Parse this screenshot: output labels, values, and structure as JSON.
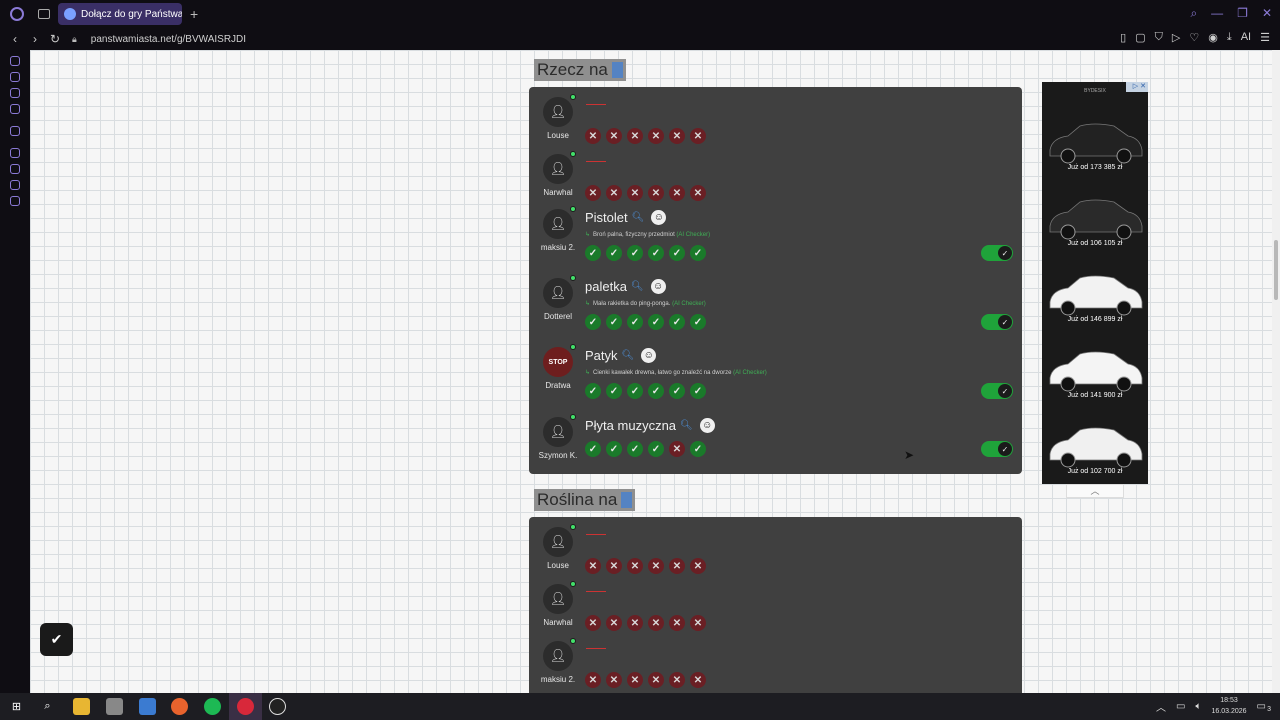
{
  "browser": {
    "tab_title": "Dołącz do gry Państwa Mi...",
    "url": "panstwamiasta.net/g/BVWAISRJDI",
    "ai_label": "AI"
  },
  "sections": [
    {
      "title": "Rzecz na",
      "rows": [
        {
          "player": "Louse",
          "answer": "",
          "description": "",
          "votes": [
            "no",
            "no",
            "no",
            "no",
            "no",
            "no"
          ],
          "has_toggle": false,
          "avatar": "user-icon"
        },
        {
          "player": "Narwhal",
          "answer": "",
          "description": "",
          "votes": [
            "no",
            "no",
            "no",
            "no",
            "no",
            "no"
          ],
          "has_toggle": false,
          "avatar": "user-icon"
        },
        {
          "player": "maksiu 2.",
          "answer": "Pistolet",
          "description": "Broń palna, fizyczny przedmiot",
          "ai_checker": "(AI Checker)",
          "votes": [
            "yes",
            "yes",
            "yes",
            "yes",
            "yes",
            "yes"
          ],
          "has_toggle": true,
          "avatar": "user-icon"
        },
        {
          "player": "Dotterel",
          "answer": "paletka",
          "description": "Mała rakietka do ping-ponga.",
          "ai_checker": "(AI Checker)",
          "votes": [
            "yes",
            "yes",
            "yes",
            "yes",
            "yes",
            "yes"
          ],
          "has_toggle": true,
          "avatar": "user-icon"
        },
        {
          "player": "Dratwa",
          "answer": "Patyk",
          "description": "Cienki kawałek drewna, łatwo go znaleźć na dworze",
          "ai_checker": "(AI Checker)",
          "votes": [
            "yes",
            "yes",
            "yes",
            "yes",
            "yes",
            "yes"
          ],
          "has_toggle": true,
          "avatar": "stop-icon"
        },
        {
          "player": "Szymon K.",
          "answer": "Płyta muzyczna",
          "description": "",
          "votes": [
            "yes",
            "yes",
            "yes",
            "yes",
            "no",
            "yes"
          ],
          "has_toggle": true,
          "avatar": "user-icon"
        }
      ]
    },
    {
      "title": "Roślina na",
      "rows": [
        {
          "player": "Louse",
          "answer": "",
          "votes": [
            "no",
            "no",
            "no",
            "no",
            "no",
            "no"
          ]
        },
        {
          "player": "Narwhal",
          "answer": "",
          "votes": [
            "no",
            "no",
            "no",
            "no",
            "no",
            "no"
          ]
        },
        {
          "player": "maksiu 2.",
          "answer": "",
          "votes": [
            "no",
            "no",
            "no",
            "no",
            "no",
            "no"
          ]
        }
      ]
    }
  ],
  "ad": {
    "brand": "BYDESIX",
    "prices": [
      "Już od 173 385 zł",
      "Już od 106 105 zł",
      "Już od 146 899 zł",
      "Już od 141 900 zł",
      "Już od 102 700 zł"
    ],
    "car_colors": [
      "#222222",
      "#2a2a2a",
      "#f2f2f2",
      "#f4f4f4",
      "#f0f0f0"
    ]
  },
  "stop_label": "STOP",
  "clock": {
    "time": "18:53",
    "date": "16.03.2026"
  },
  "notification_count": "3",
  "colors": {
    "vote_yes": "#1a7a2a",
    "vote_no": "#6a1f24",
    "toggle_on": "#1fa33a",
    "accent": "#8b7ad6"
  }
}
